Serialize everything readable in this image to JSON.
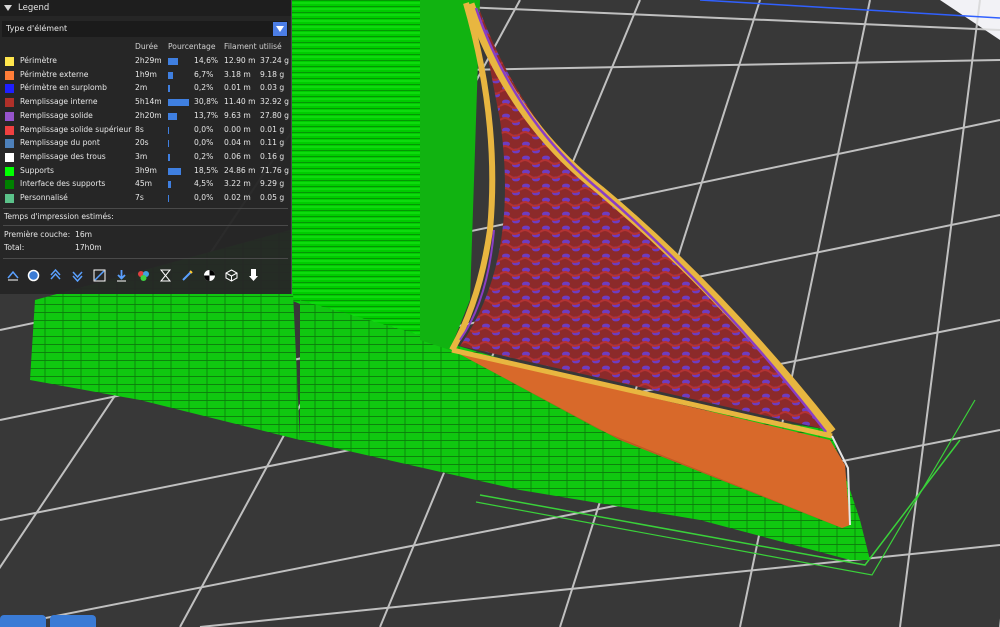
{
  "legend": {
    "title": "Legend",
    "selector_value": "Type d'élément",
    "headers": {
      "duration": "Durée",
      "percent": "Pourcentage",
      "filament": "Filament utilisé"
    },
    "rows": [
      {
        "color": "#ffe64d",
        "label": "Périmètre",
        "duration": "2h29m",
        "percent": "14,6%",
        "percent_value": 14.6,
        "length": "12.90 m",
        "weight": "37.24 g"
      },
      {
        "color": "#ff7d38",
        "label": "Périmètre externe",
        "duration": "1h9m",
        "percent": "6,7%",
        "percent_value": 6.7,
        "length": "3.18 m",
        "weight": "9.18 g"
      },
      {
        "color": "#1f1fff",
        "label": "Périmètre en surplomb",
        "duration": "2m",
        "percent": "0,2%",
        "percent_value": 0.2,
        "length": "0.01 m",
        "weight": "0.03 g"
      },
      {
        "color": "#b03029",
        "label": "Remplissage interne",
        "duration": "5h14m",
        "percent": "30,8%",
        "percent_value": 30.8,
        "length": "11.40 m",
        "weight": "32.92 g"
      },
      {
        "color": "#9654cc",
        "label": "Remplissage solide",
        "duration": "2h20m",
        "percent": "13,7%",
        "percent_value": 13.7,
        "length": "9.63 m",
        "weight": "27.80 g"
      },
      {
        "color": "#f04040",
        "label": "Remplissage solide supérieur",
        "duration": "8s",
        "percent": "0,0%",
        "percent_value": 0.0,
        "length": "0.00 m",
        "weight": "0.01 g"
      },
      {
        "color": "#4d80ba",
        "label": "Remplissage du pont",
        "duration": "20s",
        "percent": "0,0%",
        "percent_value": 0.0,
        "length": "0.04 m",
        "weight": "0.11 g"
      },
      {
        "color": "#ffffff",
        "label": "Remplissage des trous",
        "duration": "3m",
        "percent": "0,2%",
        "percent_value": 0.2,
        "length": "0.06 m",
        "weight": "0.16 g"
      },
      {
        "color": "#00ff00",
        "label": "Supports",
        "duration": "3h9m",
        "percent": "18,5%",
        "percent_value": 18.5,
        "length": "24.86 m",
        "weight": "71.76 g"
      },
      {
        "color": "#008000",
        "label": "Interface des supports",
        "duration": "45m",
        "percent": "4,5%",
        "percent_value": 4.5,
        "length": "3.22 m",
        "weight": "9.29 g"
      },
      {
        "color": "#5bc28a",
        "label": "Personnalisé",
        "duration": "7s",
        "percent": "0,0%",
        "percent_value": 0.0,
        "length": "0.02 m",
        "weight": "0.05 g"
      }
    ],
    "estimated_label": "Temps d'impression estimés:",
    "first_layer_label": "Première couche:",
    "first_layer_value": "16m",
    "total_label": "Total:",
    "total_value": "17h0m"
  },
  "toolbar": {
    "icons": [
      "travel-icon",
      "wipe-icon",
      "retractions-icon",
      "deretractions-icon",
      "seams-icon",
      "tool-changes-icon",
      "color-changes-icon",
      "pause-print-icon",
      "custom-gcode-icon",
      "center-of-gravity-icon",
      "shells-icon",
      "tool-marker-icon"
    ]
  },
  "colors": {
    "accent": "#4c7ee6",
    "bar": "#3f7fe0",
    "panel": "#262626",
    "bed": "#3a3a3a",
    "bed_grid": "#d8d8d8"
  }
}
